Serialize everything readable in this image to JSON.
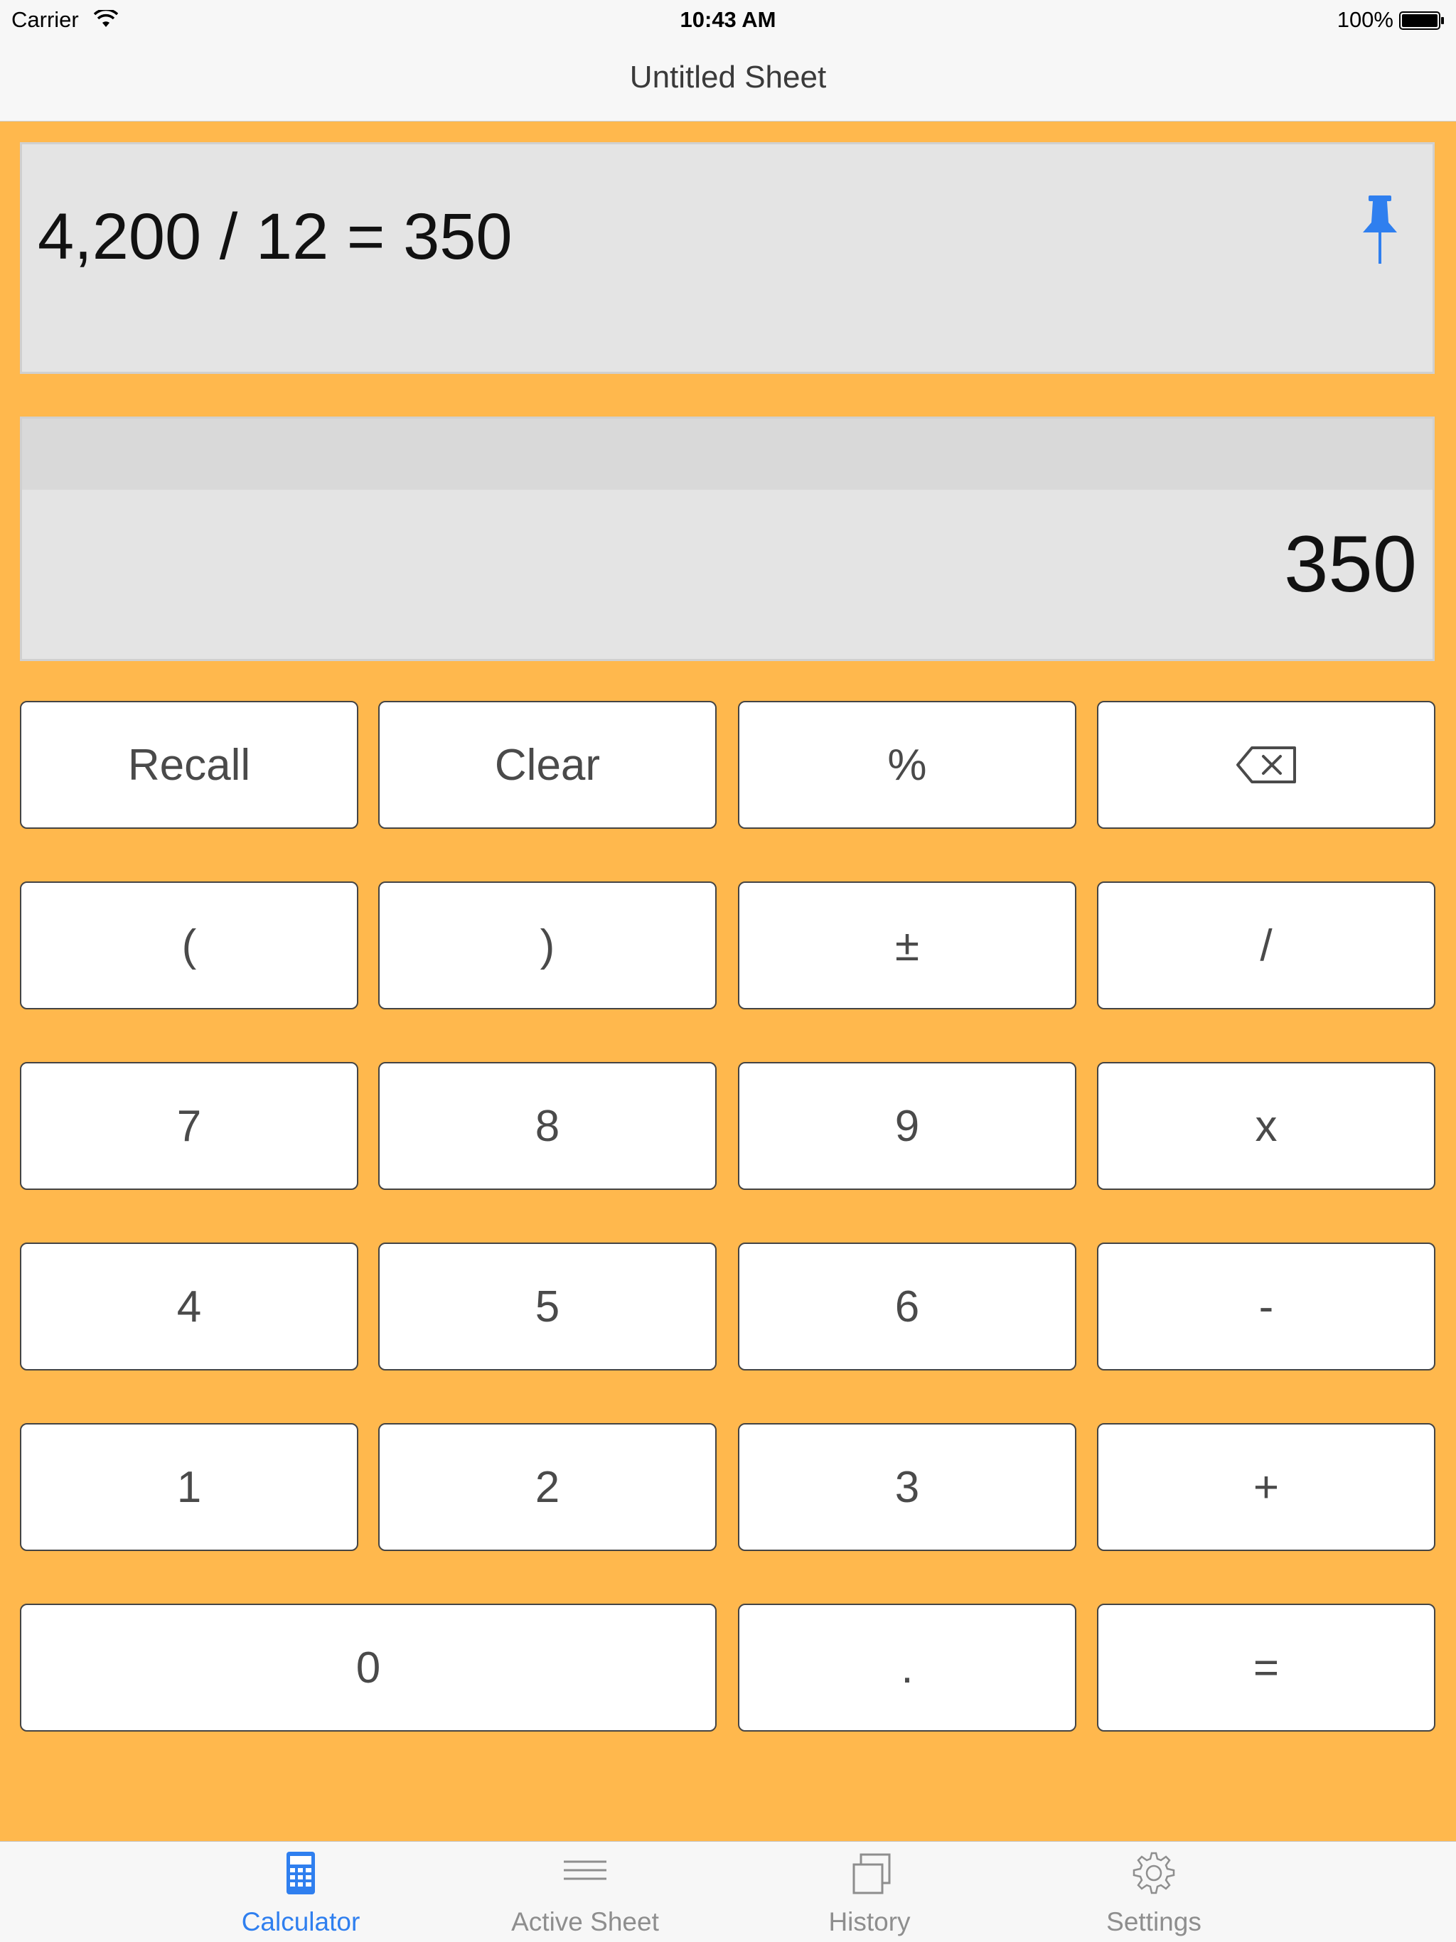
{
  "status_bar": {
    "carrier": "Carrier",
    "time": "10:43 AM",
    "battery": "100%"
  },
  "nav": {
    "title": "Untitled Sheet"
  },
  "expression": {
    "text": "4,200 / 12  = 350",
    "pin_icon": "pin-icon",
    "pin_color": "#2f7fef"
  },
  "result": {
    "value": "350"
  },
  "keys": {
    "recall": "Recall",
    "clear": "Clear",
    "percent": "%",
    "backspace_icon": "backspace-icon",
    "open_paren": "(",
    "close_paren": ")",
    "plus_minus": "±",
    "divide": "/",
    "seven": "7",
    "eight": "8",
    "nine": "9",
    "multiply": "x",
    "four": "4",
    "five": "5",
    "six": "6",
    "minus": "-",
    "one": "1",
    "two": "2",
    "three": "3",
    "plus": "+",
    "zero": "0",
    "decimal": ".",
    "equals": "="
  },
  "tabs": [
    {
      "label": "Calculator",
      "icon": "calculator-icon",
      "active": true
    },
    {
      "label": "Active Sheet",
      "icon": "lines-icon",
      "active": false
    },
    {
      "label": "History",
      "icon": "stacked-pages-icon",
      "active": false
    },
    {
      "label": "Settings",
      "icon": "gear-icon",
      "active": false
    }
  ],
  "colors": {
    "background": "#ffb84d",
    "accent": "#2f7fef",
    "panel": "#e4e4e4"
  }
}
